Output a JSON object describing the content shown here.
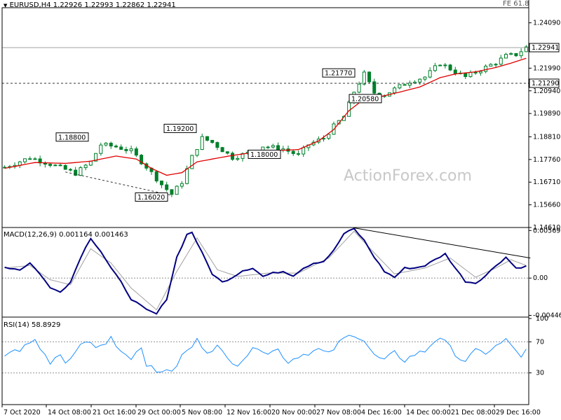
{
  "header": {
    "arrow": "▼",
    "symbol": "EURUSD,H4",
    "ohlc": "1.22926 1.22993 1.22862 1.22941",
    "fe_label": "FE 61.8"
  },
  "watermark": "ActionForex.com",
  "colors": {
    "candle": "#00802b",
    "ma": "#e00000",
    "macd": "#000080",
    "signal": "#a0a0a0",
    "rsi": "#1e90ff",
    "trendline": "#000000",
    "grid": "#d0d0d0"
  },
  "time_axis": [
    "7 Oct 2020",
    "14 Oct 08:00",
    "21 Oct 16:00",
    "29 Oct 00:00",
    "5 Nov 08:00",
    "12 Nov 16:00",
    "20 Nov 00:00",
    "27 Nov 08:00",
    "4 Dec 16:00",
    "14 Dec 00:00",
    "21 Dec 08:00",
    "29 Dec 16:00"
  ],
  "chart_data": [
    {
      "type": "candlestick",
      "title": "EURUSD,H4",
      "y_ticks": [
        "1.24090",
        "1.21990",
        "1.20940",
        "1.19890",
        "1.18810",
        "1.17760",
        "1.16710",
        "1.15660",
        "1.14610"
      ],
      "ylim": [
        1.1461,
        1.2479
      ],
      "levels": [
        {
          "label": "1.22941",
          "value": 1.22941,
          "style": "solid"
        },
        {
          "label": "1.21290",
          "value": 1.2129,
          "style": "dashed"
        }
      ],
      "annotations": [
        {
          "label": "1.18800",
          "value": 1.188
        },
        {
          "label": "1.16020",
          "value": 1.1602
        },
        {
          "label": "1.19200",
          "value": 1.192
        },
        {
          "label": "1.18000",
          "value": 1.18
        },
        {
          "label": "1.21770",
          "value": 1.2177
        },
        {
          "label": "1.20580",
          "value": 1.2058
        }
      ],
      "close_path": [
        [
          0,
          1.174
        ],
        [
          5,
          1.1785
        ],
        [
          9,
          1.1755
        ],
        [
          14,
          1.1712
        ],
        [
          17,
          1.1765
        ],
        [
          19,
          1.1845
        ],
        [
          22,
          1.1835
        ],
        [
          25,
          1.1815
        ],
        [
          28,
          1.1742
        ],
        [
          31,
          1.166
        ],
        [
          33,
          1.1615
        ],
        [
          35,
          1.1672
        ],
        [
          37,
          1.1788
        ],
        [
          39,
          1.1875
        ],
        [
          41,
          1.1855
        ],
        [
          43,
          1.182
        ],
        [
          45,
          1.1785
        ],
        [
          48,
          1.1805
        ],
        [
          51,
          1.1838
        ],
        [
          55,
          1.1825
        ],
        [
          58,
          1.1795
        ],
        [
          60,
          1.1845
        ],
        [
          63,
          1.1875
        ],
        [
          65,
          1.193
        ],
        [
          67,
          1.1975
        ],
        [
          69,
          1.209
        ],
        [
          71,
          1.2172
        ],
        [
          73,
          1.2085
        ],
        [
          75,
          1.2075
        ],
        [
          77,
          1.2102
        ],
        [
          80,
          1.2138
        ],
        [
          83,
          1.2158
        ],
        [
          86,
          1.2222
        ],
        [
          89,
          1.2182
        ],
        [
          91,
          1.2158
        ],
        [
          94,
          1.2192
        ],
        [
          97,
          1.2225
        ],
        [
          99,
          1.2255
        ],
        [
          101,
          1.2262
        ],
        [
          103,
          1.2295
        ]
      ],
      "ma_path": [
        [
          0,
          1.1735
        ],
        [
          6,
          1.1762
        ],
        [
          12,
          1.1758
        ],
        [
          17,
          1.1768
        ],
        [
          22,
          1.1792
        ],
        [
          26,
          1.1778
        ],
        [
          29,
          1.1735
        ],
        [
          32,
          1.1703
        ],
        [
          35,
          1.1715
        ],
        [
          38,
          1.1765
        ],
        [
          41,
          1.1778
        ],
        [
          45,
          1.1795
        ],
        [
          49,
          1.1808
        ],
        [
          54,
          1.1818
        ],
        [
          58,
          1.1822
        ],
        [
          62,
          1.1862
        ],
        [
          65,
          1.1915
        ],
        [
          68,
          1.2002
        ],
        [
          71,
          1.2056
        ],
        [
          74,
          1.2066
        ],
        [
          78,
          1.2088
        ],
        [
          82,
          1.2112
        ],
        [
          86,
          1.2155
        ],
        [
          89,
          1.2172
        ],
        [
          93,
          1.2182
        ],
        [
          97,
          1.2202
        ],
        [
          100,
          1.2222
        ],
        [
          103,
          1.2245
        ]
      ]
    },
    {
      "type": "line",
      "title": "MACD(12,26,9) 0.001164 0.001463",
      "y_ticks": [
        "0.00569",
        "0.00",
        "-0.00446"
      ],
      "ylim": [
        -0.00467,
        0.00605
      ],
      "macd": [
        [
          0,
          0.0013
        ],
        [
          3,
          0.001
        ],
        [
          5,
          0.0018
        ],
        [
          7,
          0.0005
        ],
        [
          9,
          -0.0012
        ],
        [
          11,
          -0.0016
        ],
        [
          13,
          -0.0005
        ],
        [
          15,
          0.0025
        ],
        [
          17,
          0.0048
        ],
        [
          19,
          0.0032
        ],
        [
          21,
          0.0012
        ],
        [
          23,
          -0.0005
        ],
        [
          25,
          -0.0025
        ],
        [
          28,
          -0.0038
        ],
        [
          30,
          -0.0043
        ],
        [
          32,
          -0.0025
        ],
        [
          34,
          0.0025
        ],
        [
          36,
          0.0052
        ],
        [
          37,
          0.0055
        ],
        [
          39,
          0.003
        ],
        [
          41,
          0.0005
        ],
        [
          43,
          -0.0005
        ],
        [
          45,
          0.0001
        ],
        [
          47,
          0.0009
        ],
        [
          49,
          0.0012
        ],
        [
          51,
          0.0002
        ],
        [
          53,
          0.0006
        ],
        [
          55,
          0.0008
        ],
        [
          57,
          0.0003
        ],
        [
          59,
          0.0012
        ],
        [
          61,
          0.0018
        ],
        [
          63,
          0.002
        ],
        [
          65,
          0.0033
        ],
        [
          67,
          0.0053
        ],
        [
          69,
          0.0059
        ],
        [
          71,
          0.0045
        ],
        [
          73,
          0.0025
        ],
        [
          75,
          0.0008
        ],
        [
          77,
          0.0001
        ],
        [
          79,
          0.0012
        ],
        [
          81,
          0.0012
        ],
        [
          83,
          0.0015
        ],
        [
          85,
          0.0022
        ],
        [
          87,
          0.0029
        ],
        [
          89,
          0.0012
        ],
        [
          91,
          -0.0004
        ],
        [
          93,
          -0.0006
        ],
        [
          95,
          0.0003
        ],
        [
          97,
          0.0015
        ],
        [
          99,
          0.0025
        ],
        [
          101,
          0.0012
        ],
        [
          103,
          0.0014
        ]
      ],
      "signal": [
        [
          0,
          0.0012
        ],
        [
          5,
          0.0015
        ],
        [
          9,
          -0.0002
        ],
        [
          13,
          -0.0008
        ],
        [
          17,
          0.0035
        ],
        [
          21,
          0.0018
        ],
        [
          25,
          -0.0012
        ],
        [
          30,
          -0.0038
        ],
        [
          34,
          0.0008
        ],
        [
          38,
          0.0048
        ],
        [
          42,
          0.001
        ],
        [
          46,
          0.0002
        ],
        [
          52,
          0.0006
        ],
        [
          58,
          0.0006
        ],
        [
          64,
          0.0024
        ],
        [
          69,
          0.0056
        ],
        [
          73,
          0.003
        ],
        [
          77,
          0.0005
        ],
        [
          83,
          0.0012
        ],
        [
          88,
          0.0024
        ],
        [
          93,
          0.0001
        ],
        [
          97,
          0.0012
        ],
        [
          100,
          0.0022
        ],
        [
          103,
          0.0015
        ]
      ],
      "trendline": [
        [
          69,
          0.006
        ],
        [
          103,
          0.0024
        ]
      ]
    },
    {
      "type": "line",
      "title": "RSI(14) 58.8929",
      "y_ticks": [
        "100",
        "70",
        "30"
      ],
      "ylim": [
        0,
        100
      ],
      "levels": [
        70,
        30
      ],
      "values": [
        [
          0,
          52
        ],
        [
          2,
          58
        ],
        [
          4,
          63
        ],
        [
          6,
          70
        ],
        [
          8,
          55
        ],
        [
          9,
          42
        ],
        [
          11,
          52
        ],
        [
          12,
          40
        ],
        [
          14,
          58
        ],
        [
          16,
          72
        ],
        [
          18,
          62
        ],
        [
          20,
          68
        ],
        [
          21,
          76
        ],
        [
          23,
          58
        ],
        [
          25,
          50
        ],
        [
          27,
          64
        ],
        [
          28,
          42
        ],
        [
          30,
          30
        ],
        [
          32,
          36
        ],
        [
          33,
          29
        ],
        [
          35,
          52
        ],
        [
          37,
          64
        ],
        [
          38,
          72
        ],
        [
          40,
          58
        ],
        [
          42,
          64
        ],
        [
          44,
          48
        ],
        [
          46,
          42
        ],
        [
          48,
          54
        ],
        [
          50,
          64
        ],
        [
          52,
          56
        ],
        [
          54,
          60
        ],
        [
          56,
          44
        ],
        [
          58,
          52
        ],
        [
          60,
          56
        ],
        [
          62,
          60
        ],
        [
          64,
          54
        ],
        [
          66,
          68
        ],
        [
          67,
          74
        ],
        [
          69,
          80
        ],
        [
          71,
          72
        ],
        [
          73,
          52
        ],
        [
          75,
          46
        ],
        [
          77,
          56
        ],
        [
          79,
          46
        ],
        [
          81,
          54
        ],
        [
          83,
          58
        ],
        [
          85,
          72
        ],
        [
          86,
          76
        ],
        [
          88,
          62
        ],
        [
          90,
          48
        ],
        [
          91,
          46
        ],
        [
          93,
          58
        ],
        [
          95,
          56
        ],
        [
          97,
          64
        ],
        [
          99,
          72
        ],
        [
          101,
          60
        ],
        [
          102,
          48
        ],
        [
          103,
          59
        ]
      ]
    }
  ]
}
